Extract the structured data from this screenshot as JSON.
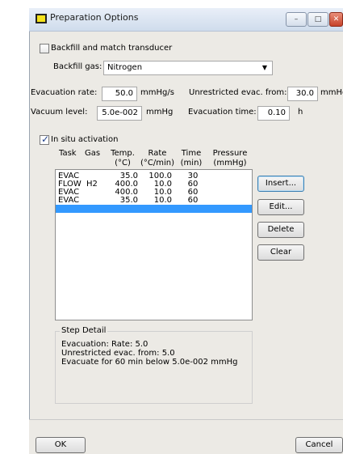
{
  "window": {
    "title": "Preparation Options",
    "minimize": "–",
    "maximize": "□",
    "close": "✕"
  },
  "backfill": {
    "match_label": "Backfill and match transducer",
    "match_checked": false,
    "gas_label": "Backfill gas:",
    "gas_value": "Nitrogen"
  },
  "evacuation": {
    "rate_label": "Evacuation rate:",
    "rate_value": "50.0",
    "rate_unit": "mmHg/s",
    "unrestricted_label": "Unrestricted evac. from:",
    "unrestricted_value": "30.0",
    "unrestricted_unit": "mmHg"
  },
  "vacuum": {
    "level_label": "Vacuum level:",
    "level_value": "5.0e-002",
    "level_unit": "mmHg",
    "time_label": "Evacuation time:",
    "time_value": "0.10",
    "time_unit": "h"
  },
  "activation": {
    "label": "In situ activation",
    "checked": true,
    "columns": [
      {
        "line1": "Task",
        "line2": ""
      },
      {
        "line1": "Gas",
        "line2": ""
      },
      {
        "line1": "Temp.",
        "line2": "(°C)"
      },
      {
        "line1": "Rate",
        "line2": "(°C/min)"
      },
      {
        "line1": "Time",
        "line2": "(min)"
      },
      {
        "line1": "Pressure",
        "line2": "(mmHg)"
      }
    ],
    "rows": [
      {
        "task": "EVAC",
        "gas": "",
        "temp": "35.0",
        "rate": "100.0",
        "time": "30",
        "pressure": ""
      },
      {
        "task": "FLOW",
        "gas": "H2",
        "temp": "400.0",
        "rate": "10.0",
        "time": "60",
        "pressure": ""
      },
      {
        "task": "EVAC",
        "gas": "",
        "temp": "400.0",
        "rate": "10.0",
        "time": "60",
        "pressure": ""
      },
      {
        "task": "EVAC",
        "gas": "",
        "temp": "35.0",
        "rate": "10.0",
        "time": "60",
        "pressure": ""
      }
    ],
    "buttons": {
      "insert": "Insert...",
      "edit": "Edit...",
      "delete": "Delete",
      "clear": "Clear"
    }
  },
  "step_detail": {
    "title": "Step Detail",
    "lines": [
      "Evacuation:  Rate: 5.0",
      "Unrestricted evac. from: 5.0",
      "Evacuate for 60 min below 5.0e-002 mmHg"
    ]
  },
  "footer": {
    "ok": "OK",
    "cancel": "Cancel"
  },
  "colors": {
    "selection": "#3399ff",
    "dialog_bg": "#eceae5",
    "title_icon": "#f5e21b"
  }
}
